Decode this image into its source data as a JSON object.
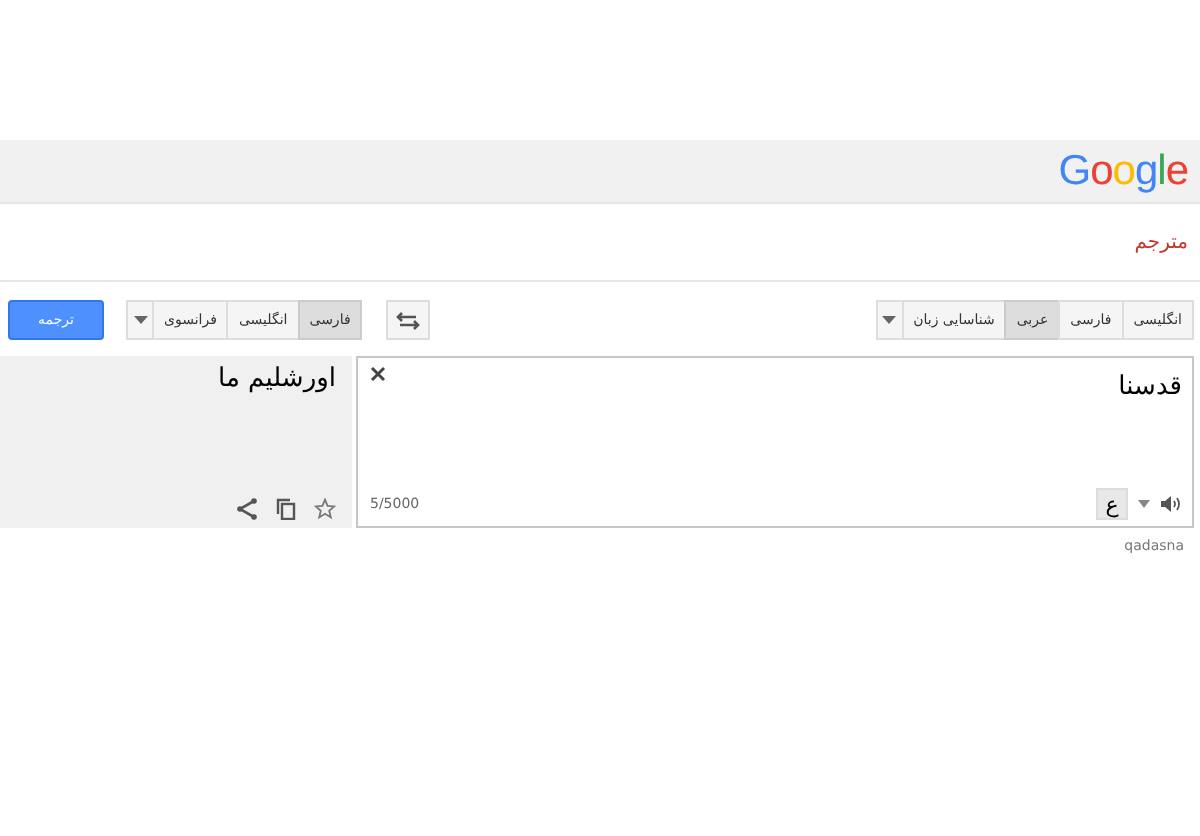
{
  "header": {
    "logo": "Google"
  },
  "app_title": "مترجم",
  "source_languages": [
    {
      "label": "انگلیسی",
      "selected": false
    },
    {
      "label": "فارسی",
      "selected": false
    },
    {
      "label": "عربی",
      "selected": true
    },
    {
      "label": "شناسایی زبان",
      "selected": false
    }
  ],
  "target_languages": [
    {
      "label": "فارسی",
      "selected": true
    },
    {
      "label": "انگلیسی",
      "selected": false
    },
    {
      "label": "فرانسوی",
      "selected": false
    }
  ],
  "translate_button": "ترجمه",
  "source": {
    "value": "قدسنا",
    "char_count": "5/5000",
    "input_tool": "ع"
  },
  "target": {
    "text": "اورشلیم ما"
  },
  "transliteration": "qadasna"
}
